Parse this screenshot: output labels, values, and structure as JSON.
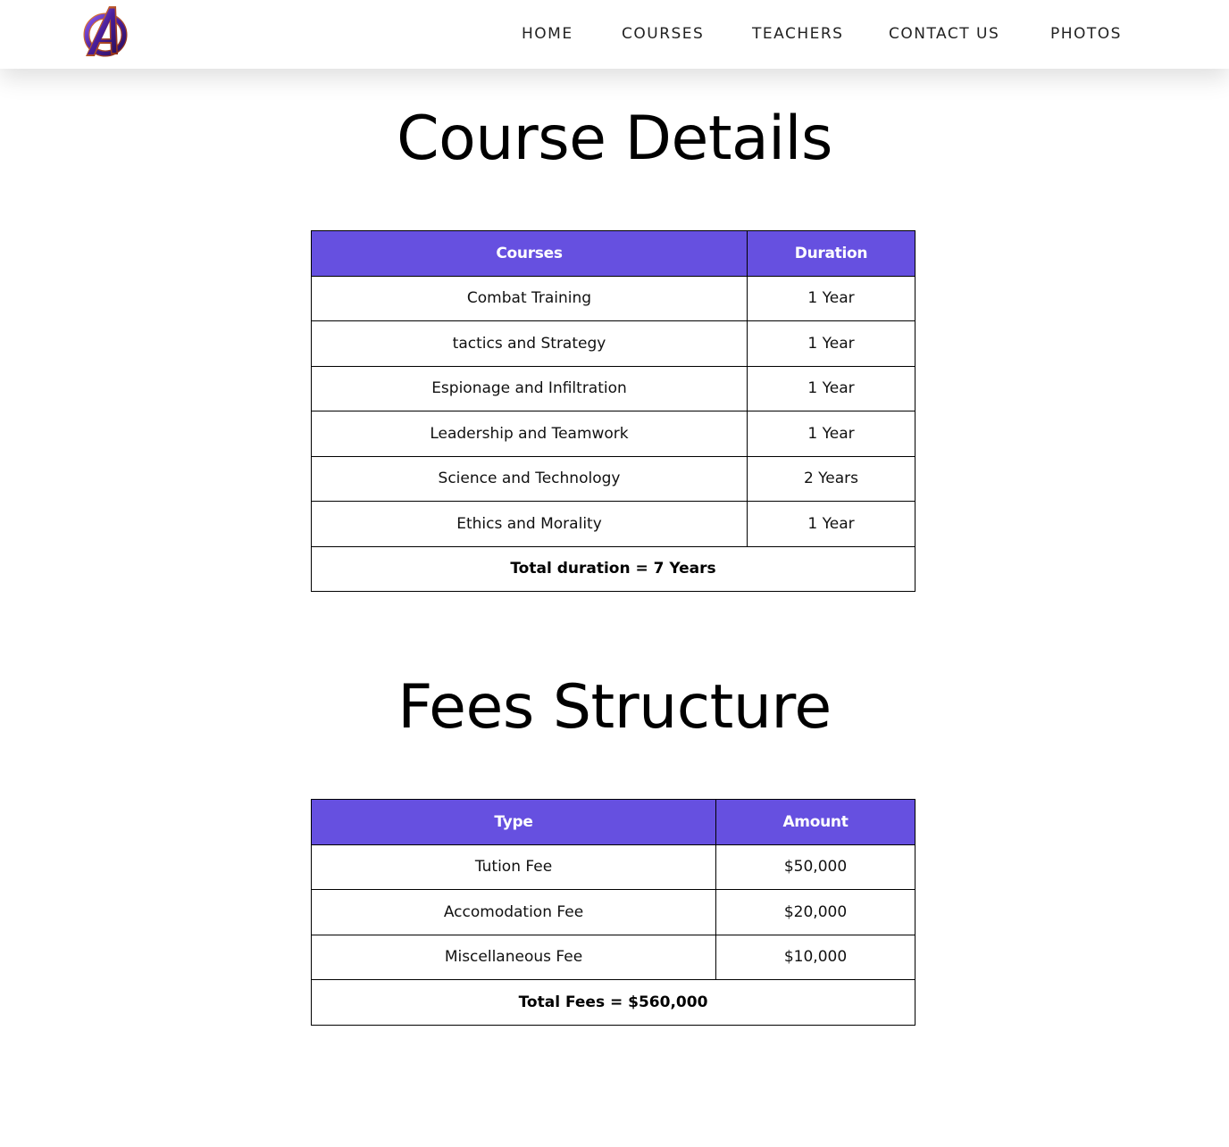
{
  "nav": {
    "items": [
      {
        "label": "HOME"
      },
      {
        "label": "COURSES"
      },
      {
        "label": "TEACHERS"
      },
      {
        "label": "CONTACT US"
      },
      {
        "label": "PHOTOS"
      }
    ]
  },
  "logo": {
    "icon": "avengers-logo-icon",
    "colors": {
      "primary": "#5a2da8",
      "accent": "#c25a2e"
    }
  },
  "colors": {
    "table_header": "#6650e0"
  },
  "courses": {
    "title": "Course Details",
    "headers": [
      "Courses",
      "Duration"
    ],
    "rows": [
      [
        "Combat Training",
        "1 Year"
      ],
      [
        "tactics and Strategy",
        "1 Year"
      ],
      [
        "Espionage and Infiltration",
        "1 Year"
      ],
      [
        "Leadership and Teamwork",
        "1 Year"
      ],
      [
        "Science and Technology",
        "2 Years"
      ],
      [
        "Ethics and Morality",
        "1 Year"
      ]
    ],
    "total": "Total duration = 7 Years"
  },
  "fees": {
    "title": "Fees Structure",
    "headers": [
      "Type",
      "Amount"
    ],
    "rows": [
      [
        "Tution Fee",
        "$50,000"
      ],
      [
        "Accomodation Fee",
        "$20,000"
      ],
      [
        "Miscellaneous Fee",
        "$10,000"
      ]
    ],
    "total": "Total Fees = $560,000"
  }
}
